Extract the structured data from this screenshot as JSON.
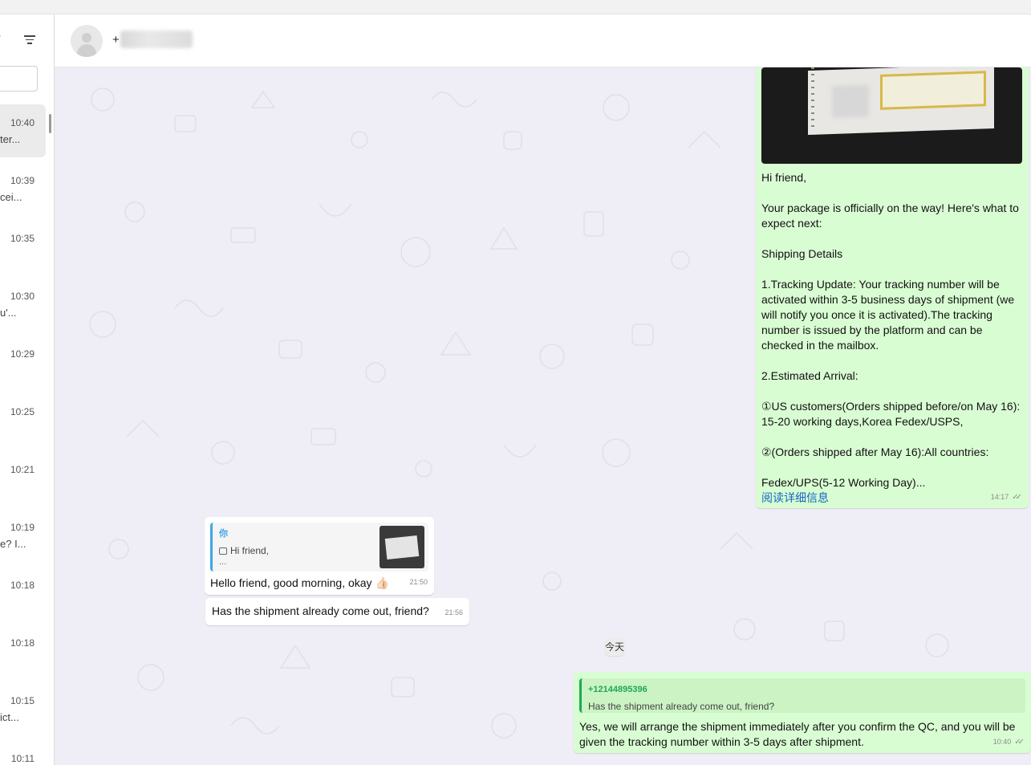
{
  "sidebar": {
    "chats": [
      {
        "time": "10:40",
        "snippet": "ter..."
      },
      {
        "time": "10:39",
        "snippet": "cei..."
      },
      {
        "time": "10:35",
        "snippet": ""
      },
      {
        "time": "10:30",
        "snippet": "u'..."
      },
      {
        "time": "10:29",
        "snippet": ""
      },
      {
        "time": "10:25",
        "snippet": ""
      },
      {
        "time": "10:21",
        "snippet": ""
      },
      {
        "time": "10:19",
        "snippet": "e? I..."
      },
      {
        "time": "10:18",
        "snippet": ""
      },
      {
        "time": "10:18",
        "snippet": ""
      },
      {
        "time": "10:15",
        "snippet": "ict..."
      },
      {
        "time": "10:11",
        "snippet": ""
      }
    ]
  },
  "header": {
    "contact_name": "+"
  },
  "messages": {
    "outgoing_package": {
      "text": "Hi friend,\n\nYour package is officially on the way!  Here's what to expect next:\n\nShipping Details\n\n1.Tracking Update: Your tracking number will be activated within 3-5 business days of shipment (we will notify you once it is activated).The tracking number is issued by the platform and can be checked in the mailbox.\n\n2.Estimated Arrival:\n\n①US customers(Orders shipped before/on May 16): 15-20 working days,Korea Fedex/USPS,\n\n②(Orders shipped after May 16):All countries:\n\nFedex/UPS(5-12 Working Day)...",
      "read_more": "阅读详细信息",
      "time": "14:17"
    },
    "incoming_reply": {
      "quote_author": "你",
      "quote_text": "Hi friend,",
      "quote_more": "...",
      "text": "Hello friend, good morning, okay 👍🏻",
      "time": "21:50"
    },
    "incoming_question": {
      "text": "Has the shipment already come out, friend?",
      "time": "21:56"
    },
    "date_divider": "今天",
    "outgoing_answer": {
      "quote_author": "+12144895396",
      "quote_text": "Has the shipment already come out, friend?",
      "text": "Yes, we will arrange the shipment immediately after you confirm the QC, and you will be given the tracking number within 3-5 days after shipment.",
      "time": "10:40"
    }
  }
}
